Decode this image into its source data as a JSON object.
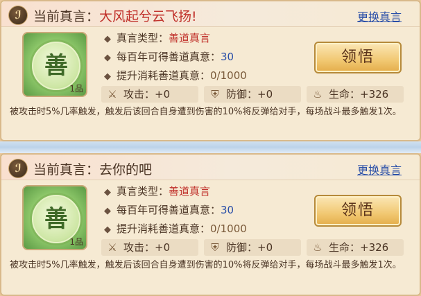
{
  "cards": [
    {
      "title_prefix": "当前真言：",
      "title_name": "大风起兮云飞扬!",
      "switch_label": "更换真言",
      "art_glyph": "善",
      "art_grade": "1品",
      "attrs": [
        {
          "label": "真言类型：",
          "value": "善道真言"
        },
        {
          "label": "每百年可得善道真意：",
          "value": "30"
        },
        {
          "label": "提升消耗善道真意：",
          "value": "0/1000"
        }
      ],
      "enlighten_label": "领悟",
      "stats": [
        {
          "icon": "sword-icon",
          "label": "攻击：",
          "value": "+0"
        },
        {
          "icon": "shield-icon",
          "label": "防御：",
          "value": "+0"
        },
        {
          "icon": "life-icon",
          "label": "生命：",
          "value": "+326"
        }
      ],
      "description": "被攻击时5%几率触发，触发后该回合自身遭到伤害的10%将反弹给对手，每场战斗最多触发1次。"
    },
    {
      "title_prefix": "当前真言：",
      "title_name": "去你的吧",
      "switch_label": "更换真言",
      "art_glyph": "善",
      "art_grade": "1品",
      "attrs": [
        {
          "label": "真言类型：",
          "value": "善道真言"
        },
        {
          "label": "每百年可得善道真意：",
          "value": "30"
        },
        {
          "label": "提升消耗善道真意：",
          "value": "0/1000"
        }
      ],
      "enlighten_label": "领悟",
      "stats": [
        {
          "icon": "sword-icon",
          "label": "攻击：",
          "value": "+0"
        },
        {
          "icon": "shield-icon",
          "label": "防御：",
          "value": "+0"
        },
        {
          "icon": "life-icon",
          "label": "生命：",
          "value": "+326"
        }
      ],
      "description": "被攻击时5%几率触发，触发后该回合自身遭到伤害的10%将反弹给对手，每场战斗最多触发1次。"
    }
  ]
}
